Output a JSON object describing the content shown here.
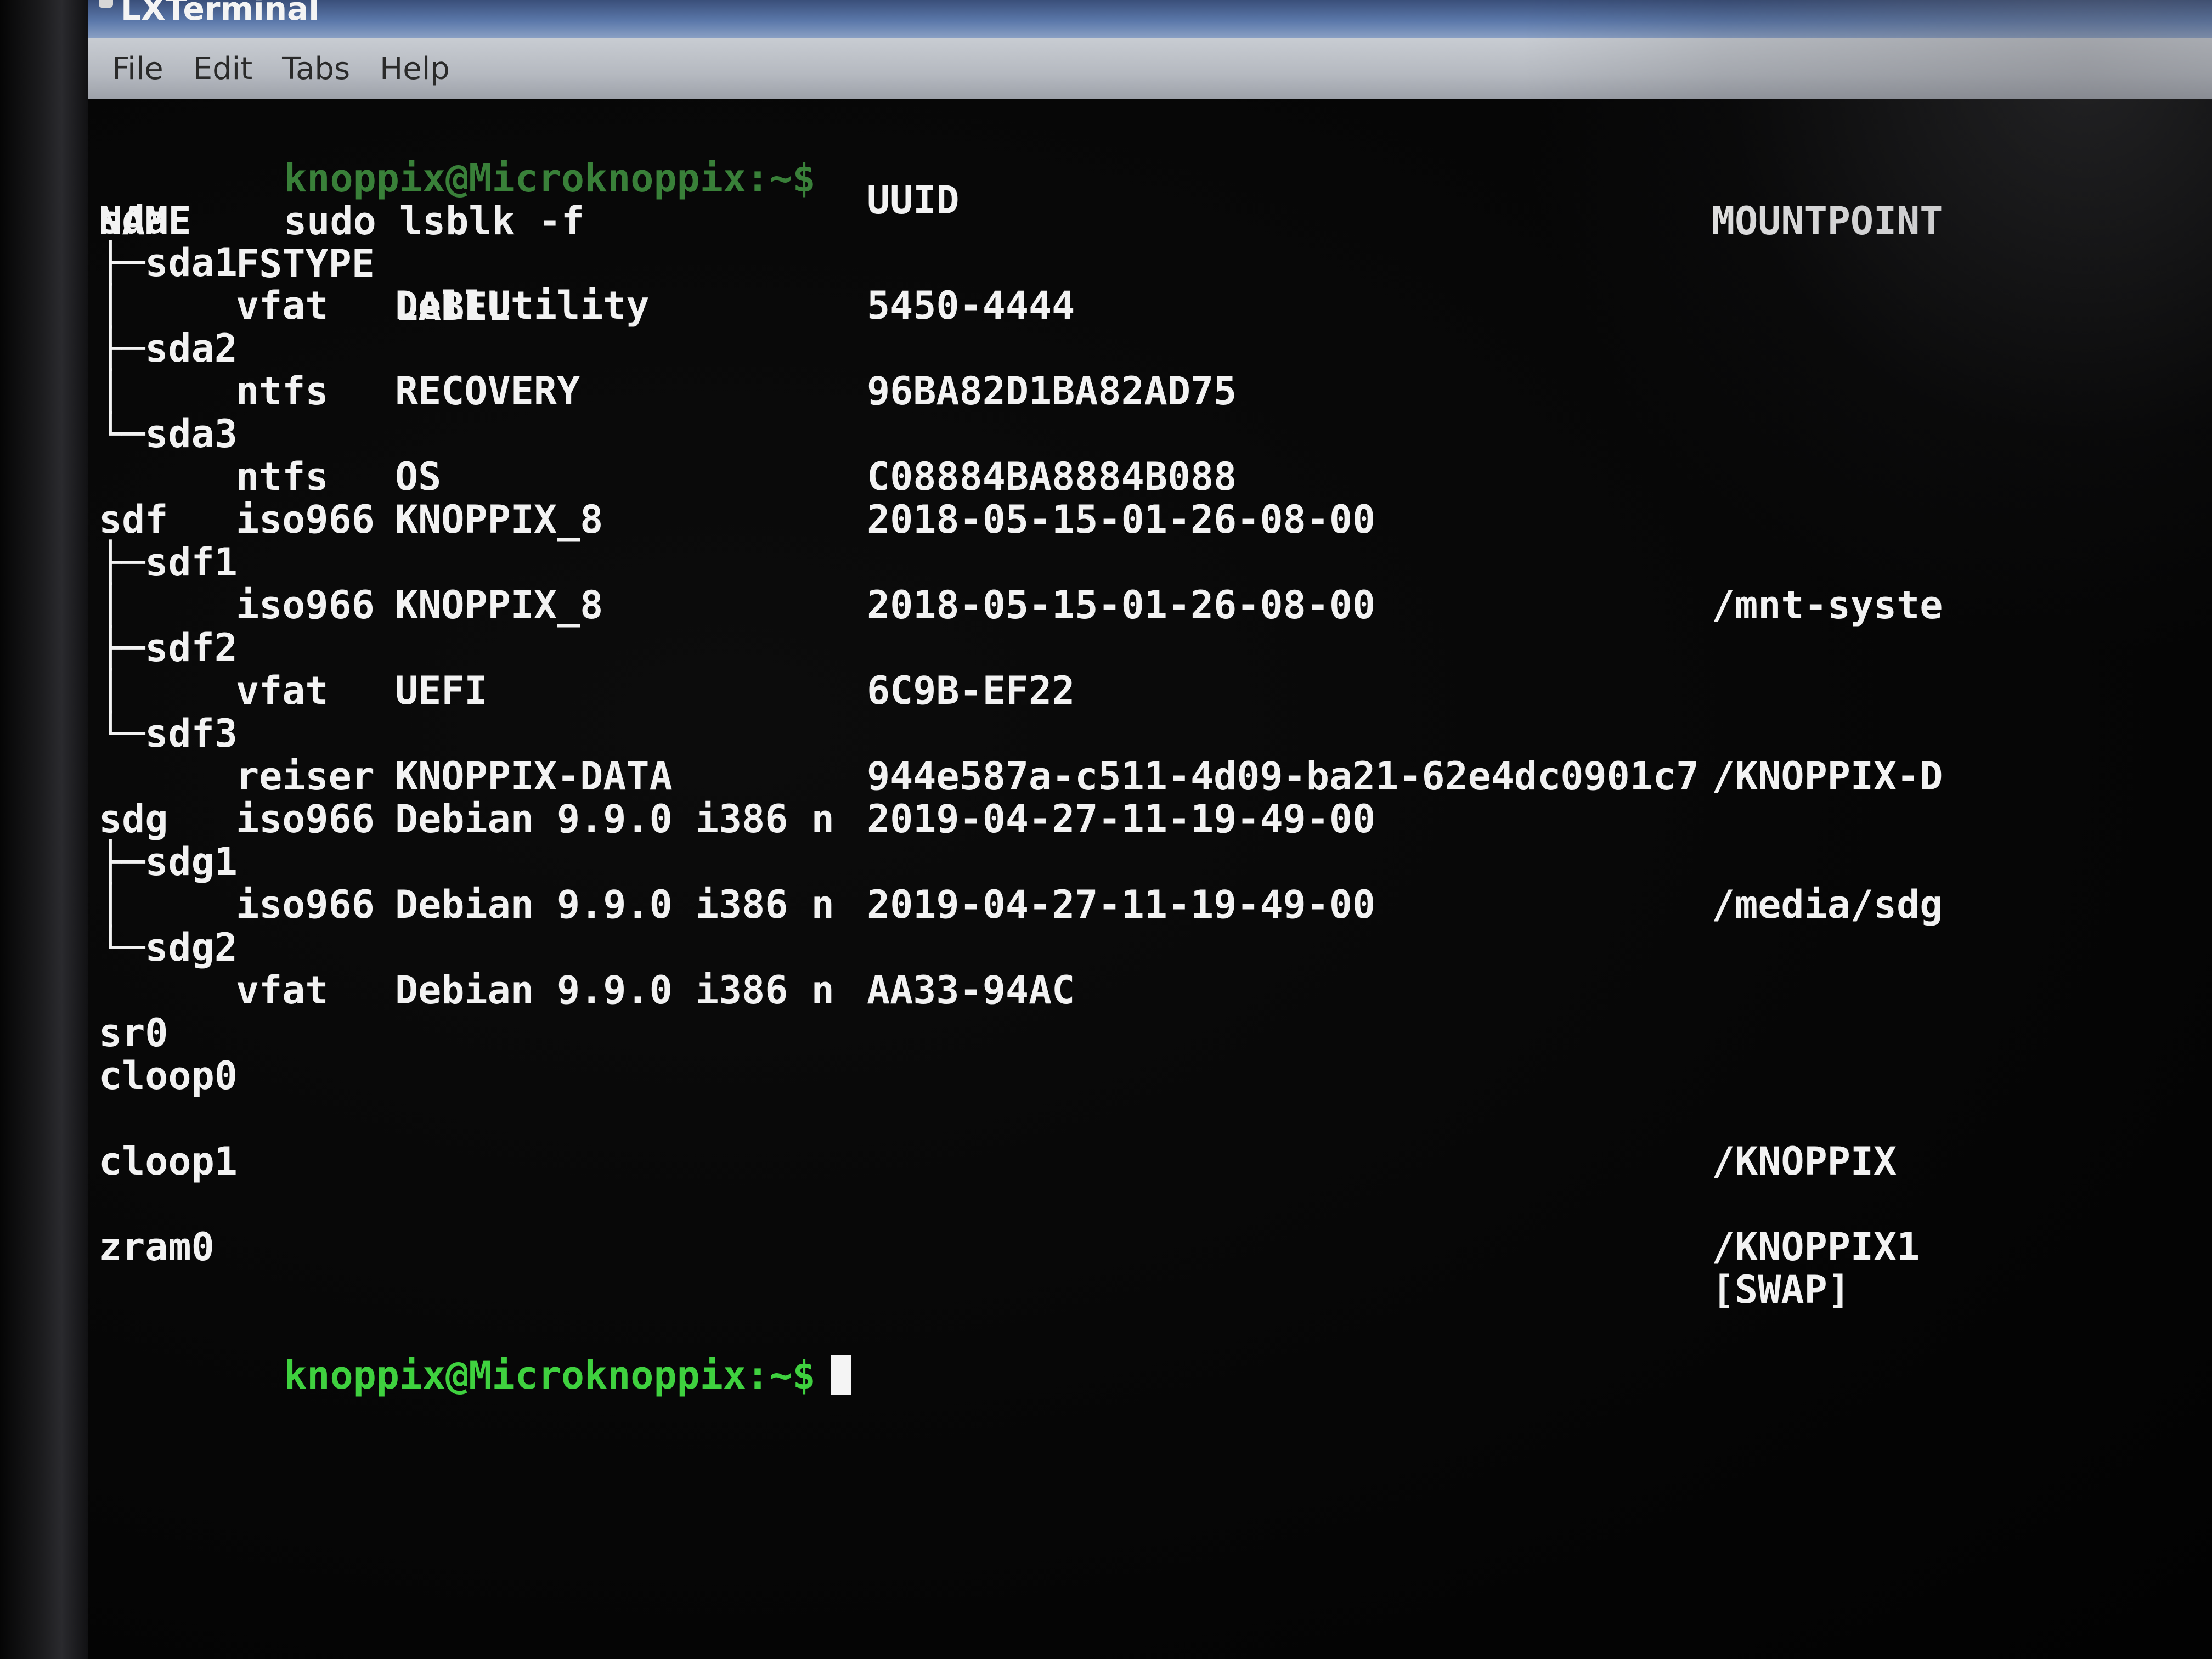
{
  "window": {
    "title": "LXTerminal"
  },
  "menu": {
    "items": [
      "File",
      "Edit",
      "Tabs",
      "Help"
    ]
  },
  "terminal": {
    "prompt_user": "knoppix@Microknoppix:~$",
    "command": "sudo lsblk -f",
    "headers": {
      "name": "NAME",
      "fstype": "FSTYPE",
      "label": "LABEL",
      "uuid": "UUID",
      "mountpoint": "MOUNTPOINT"
    },
    "rows": [
      {
        "name": "sda",
        "fstype": "",
        "label": "",
        "uuid": "",
        "mountpoint": ""
      },
      {
        "name": "├─sda1",
        "fstype": "",
        "label": "",
        "uuid": "",
        "mountpoint": ""
      },
      {
        "name": "│",
        "fstype": "vfat",
        "label": "DellUtility",
        "uuid": "5450-4444",
        "mountpoint": ""
      },
      {
        "name": "├─sda2",
        "fstype": "",
        "label": "",
        "uuid": "",
        "mountpoint": ""
      },
      {
        "name": "│",
        "fstype": "ntfs",
        "label": "RECOVERY",
        "uuid": "96BA82D1BA82AD75",
        "mountpoint": ""
      },
      {
        "name": "└─sda3",
        "fstype": "",
        "label": "",
        "uuid": "",
        "mountpoint": ""
      },
      {
        "name": "",
        "fstype": "ntfs",
        "label": "OS",
        "uuid": "C08884BA8884B088",
        "mountpoint": ""
      },
      {
        "name": "sdf",
        "fstype": "iso966",
        "label": "KNOPPIX_8",
        "uuid": "2018-05-15-01-26-08-00",
        "mountpoint": ""
      },
      {
        "name": "├─sdf1",
        "fstype": "",
        "label": "",
        "uuid": "",
        "mountpoint": ""
      },
      {
        "name": "│",
        "fstype": "iso966",
        "label": "KNOPPIX_8",
        "uuid": "2018-05-15-01-26-08-00",
        "mountpoint": "/mnt-syste"
      },
      {
        "name": "├─sdf2",
        "fstype": "",
        "label": "",
        "uuid": "",
        "mountpoint": ""
      },
      {
        "name": "│",
        "fstype": "vfat",
        "label": "UEFI",
        "uuid": "6C9B-EF22",
        "mountpoint": ""
      },
      {
        "name": "└─sdf3",
        "fstype": "",
        "label": "",
        "uuid": "",
        "mountpoint": ""
      },
      {
        "name": "",
        "fstype": "reiser",
        "label": "KNOPPIX-DATA",
        "uuid": "944e587a-c511-4d09-ba21-62e4dc0901c7",
        "mountpoint": "/KNOPPIX-D"
      },
      {
        "name": "sdg",
        "fstype": "iso966",
        "label": "Debian 9.9.0 i386 n",
        "uuid": "2019-04-27-11-19-49-00",
        "mountpoint": ""
      },
      {
        "name": "├─sdg1",
        "fstype": "",
        "label": "",
        "uuid": "",
        "mountpoint": ""
      },
      {
        "name": "│",
        "fstype": "iso966",
        "label": "Debian 9.9.0 i386 n",
        "uuid": "2019-04-27-11-19-49-00",
        "mountpoint": "/media/sdg"
      },
      {
        "name": "└─sdg2",
        "fstype": "",
        "label": "",
        "uuid": "",
        "mountpoint": ""
      },
      {
        "name": "",
        "fstype": "vfat",
        "label": "Debian 9.9.0 i386 n",
        "uuid": "AA33-94AC",
        "mountpoint": ""
      },
      {
        "name": "sr0",
        "fstype": "",
        "label": "",
        "uuid": "",
        "mountpoint": ""
      },
      {
        "name": "cloop0",
        "fstype": "",
        "label": "",
        "uuid": "",
        "mountpoint": ""
      },
      {
        "name": "",
        "fstype": "",
        "label": "",
        "uuid": "",
        "mountpoint": ""
      },
      {
        "name": "cloop1",
        "fstype": "",
        "label": "",
        "uuid": "",
        "mountpoint": "/KNOPPIX"
      },
      {
        "name": "",
        "fstype": "",
        "label": "",
        "uuid": "",
        "mountpoint": ""
      },
      {
        "name": "zram0",
        "fstype": "",
        "label": "",
        "uuid": "",
        "mountpoint": "/KNOPPIX1"
      },
      {
        "name": "",
        "fstype": "",
        "label": "",
        "uuid": "",
        "mountpoint": "[SWAP]"
      }
    ],
    "final_prompt": "knoppix@Microknoppix:~$"
  },
  "colors": {
    "prompt_green": "#3fd13f",
    "terminal_bg": "#050505",
    "text": "#f2f2f2"
  },
  "icons": {
    "app": "terminal-app-icon",
    "cursor": "block-cursor"
  }
}
